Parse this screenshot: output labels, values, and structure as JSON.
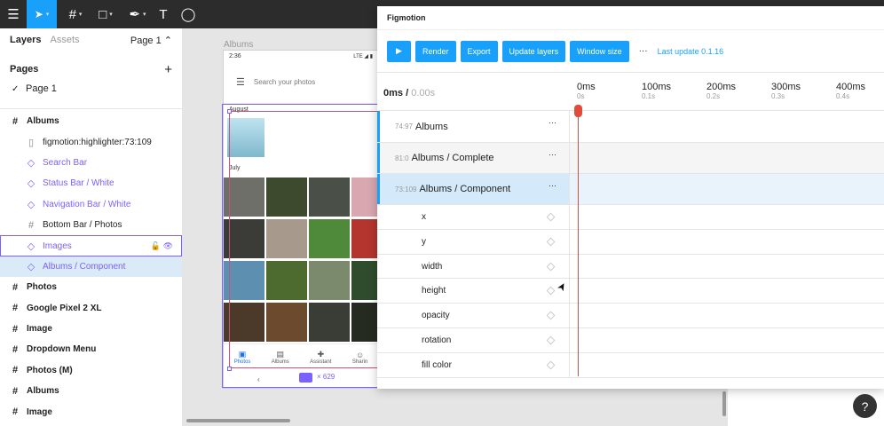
{
  "toolbar": {
    "icons": [
      "menu-icon",
      "move-icon",
      "frame-icon",
      "shape-icon",
      "pen-icon",
      "text-icon",
      "comment-icon"
    ],
    "menu_glyph": "☰",
    "move_glyph": "➤",
    "frame_glyph": "#",
    "shape_glyph": "□",
    "pen_glyph": "✒",
    "text_glyph": "T",
    "comment_glyph": "◯",
    "chevron": "▾"
  },
  "left_panel": {
    "tab_layers": "Layers",
    "tab_assets": "Assets",
    "page_selector": "Page 1 ⌃",
    "pages_title": "Pages",
    "add_glyph": "+",
    "pages": [
      {
        "label": "Page 1",
        "check": "✓"
      }
    ],
    "layers": [
      {
        "label": "Albums",
        "glyph": "#"
      },
      {
        "label": "figmotion:highlighter:73:109",
        "glyph": "▯"
      },
      {
        "label": "Search Bar",
        "glyph": "◇"
      },
      {
        "label": "Status Bar / White",
        "glyph": "◇"
      },
      {
        "label": "Navigation Bar / White",
        "glyph": "◇"
      },
      {
        "label": "Bottom Bar / Photos",
        "glyph": "#"
      },
      {
        "label": "Images",
        "glyph": "◇",
        "tools": "🔓 👁"
      },
      {
        "label": "Albums / Component",
        "glyph": "◇"
      },
      {
        "label": "Photos",
        "glyph": "#"
      },
      {
        "label": "Google Pixel 2 XL",
        "glyph": "#"
      },
      {
        "label": "Image",
        "glyph": "#"
      },
      {
        "label": "Dropdown Menu",
        "glyph": "#"
      },
      {
        "label": "Photos (M)",
        "glyph": "#"
      },
      {
        "label": "Albums",
        "glyph": "#"
      },
      {
        "label": "Image",
        "glyph": "#"
      }
    ]
  },
  "canvas": {
    "frame_label": "Albums",
    "phone": {
      "time": "2:36",
      "status_right": "LTE ◢ ▮",
      "menu_glyph": "☰",
      "search_placeholder": "Search your photos",
      "month_august": "August",
      "month_july": "July",
      "nav": [
        {
          "label": "Photos",
          "glyph": "▣"
        },
        {
          "label": "Albums",
          "glyph": "▤"
        },
        {
          "label": "Assistant",
          "glyph": "✚"
        },
        {
          "label": "Sharin",
          "glyph": "☺"
        }
      ],
      "back_glyph": "‹"
    },
    "dimension_label": "× 629"
  },
  "plugin": {
    "title": "Figmotion",
    "buttons": {
      "play": "▶",
      "render": "Render",
      "export": "Export",
      "update_layers": "Update layers",
      "window_size": "Window size",
      "more": "···"
    },
    "last_update": "Last update 0.1.16",
    "current_time": "0ms /",
    "total_time": " 0.00s",
    "ticks": [
      {
        "ms": "0ms",
        "s": "0s"
      },
      {
        "ms": "100ms",
        "s": "0.1s"
      },
      {
        "ms": "200ms",
        "s": "0.2s"
      },
      {
        "ms": "300ms",
        "s": "0.3s"
      },
      {
        "ms": "400ms",
        "s": "0.4s"
      }
    ],
    "layer_rows": [
      {
        "id": "74:97",
        "name": "Albums",
        "dots": "···"
      },
      {
        "id": "81:0",
        "name": "Albums / Complete",
        "dots": "···"
      },
      {
        "id": "73:109",
        "name": "Albums / Component",
        "dots": "···"
      }
    ],
    "properties": [
      "x",
      "y",
      "width",
      "height",
      "opacity",
      "rotation",
      "fill color"
    ]
  },
  "help_glyph": "?",
  "cursor_glyph": "➤",
  "colors": {
    "accent": "#18a0fb",
    "component": "#7b61ff",
    "playhead": "#e04b3a",
    "toolbar": "#2c2c2c"
  }
}
